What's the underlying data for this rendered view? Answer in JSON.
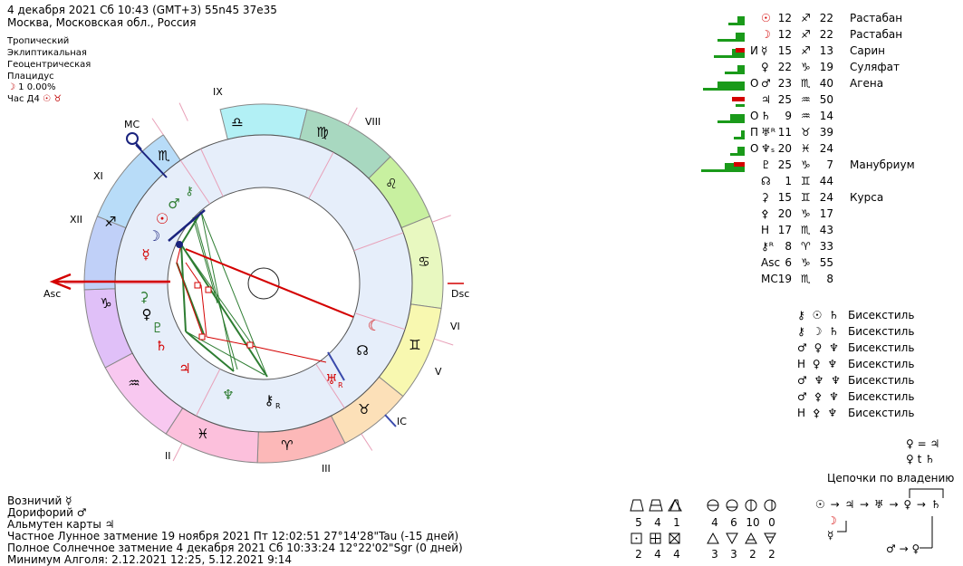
{
  "header": {
    "datetime": "4 декабря 2021  Сб  10:43 (GMT+3) 55n45  37e35",
    "place": "Москва, Московская обл., Россия",
    "settings": [
      "Тропический",
      "Эклиптикальная",
      "Геоцентрическая",
      "Плацидус"
    ],
    "moon_line_glyph": "☽",
    "moon_line_value": "1  0.00%",
    "hour_label": "Час Д4",
    "hour_glyphs": "☉ ♉"
  },
  "chart": {
    "house_labels": [
      "IX",
      "VIII",
      "VI",
      "V",
      "III",
      "II",
      "XI",
      "XII"
    ],
    "axis_labels": {
      "asc": "Asc",
      "dsc": "Dsc",
      "mc": "MC",
      "ic": "IC"
    },
    "signs": [
      "♎",
      "♍",
      "♌",
      "♋",
      "♊",
      "♉",
      "♈",
      "♓",
      "♒",
      "♑",
      "♐",
      "♏"
    ],
    "planet_glyphs": [
      "♂",
      "⚷",
      "☉",
      "☽",
      "☿",
      "♀",
      "♆",
      "⚷",
      "♅",
      "☊",
      "☾",
      "♄",
      "♃",
      "⚳",
      "♇"
    ],
    "retro_mark": "R"
  },
  "planets": [
    {
      "prefix": "",
      "glyph": "☉",
      "deg": "12",
      "sign": "♐",
      "min": "22",
      "star": "Растабан"
    },
    {
      "prefix": "",
      "glyph": "☽",
      "deg": "12",
      "sign": "♐",
      "min": "22",
      "star": "Растабан"
    },
    {
      "prefix": "И",
      "glyph": "☿",
      "deg": "15",
      "sign": "♐",
      "min": "13",
      "star": "Сарин"
    },
    {
      "prefix": "",
      "glyph": "♀",
      "deg": "22",
      "sign": "♑",
      "min": "19",
      "star": "Суляфат"
    },
    {
      "prefix": "О",
      "glyph": "♂",
      "deg": "23",
      "sign": "♏",
      "min": "40",
      "star": "Агена"
    },
    {
      "prefix": "",
      "glyph": "♃",
      "deg": "25",
      "sign": "♒",
      "min": "50",
      "star": ""
    },
    {
      "prefix": "О",
      "glyph": "♄",
      "deg": "9",
      "sign": "♒",
      "min": "14",
      "star": ""
    },
    {
      "prefix": "П",
      "glyph": "♅ᴿ",
      "deg": "11",
      "sign": "♉",
      "min": "39",
      "star": ""
    },
    {
      "prefix": "О",
      "glyph": "♆ₛ",
      "deg": "20",
      "sign": "♓",
      "min": "24",
      "star": ""
    },
    {
      "prefix": "",
      "glyph": "♇",
      "deg": "25",
      "sign": "♑",
      "min": "7",
      "star": "Манубриум"
    },
    {
      "prefix": "",
      "glyph": "☊",
      "deg": "1",
      "sign": "♊",
      "min": "44",
      "star": ""
    },
    {
      "prefix": "",
      "glyph": "⚳",
      "deg": "15",
      "sign": "♊",
      "min": "24",
      "star": "Курса"
    },
    {
      "prefix": "",
      "glyph": "⚴",
      "deg": "20",
      "sign": "♑",
      "min": "17",
      "star": ""
    },
    {
      "prefix": "",
      "glyph": "H",
      "deg": "17",
      "sign": "♏",
      "min": "43",
      "star": ""
    },
    {
      "prefix": "",
      "glyph": "⚷ᴿ",
      "deg": "8",
      "sign": "♈",
      "min": "33",
      "star": ""
    },
    {
      "prefix": "",
      "glyph": "Asc",
      "deg": "6",
      "sign": "♑",
      "min": "55",
      "star": ""
    },
    {
      "prefix": "",
      "glyph": "MC",
      "deg": "19",
      "sign": "♏",
      "min": "8",
      "star": ""
    }
  ],
  "aspects": [
    {
      "g": "⚷ ☉ ♄",
      "name": "Бисекстиль"
    },
    {
      "g": "⚷ ☽ ♄",
      "name": "Бисекстиль"
    },
    {
      "g": "♂ ♀ ♆",
      "name": "Бисекстиль"
    },
    {
      "g": "H ♀ ♆",
      "name": "Бисекстиль"
    },
    {
      "g": "♂ ♆ ♆",
      "name": "Бисекстиль"
    },
    {
      "g": "♂ ⚴ ♆",
      "name": "Бисекстиль"
    },
    {
      "g": "H ⚴ ♆",
      "name": "Бисекстиль"
    }
  ],
  "chains": {
    "eq1": "♀ = ♃",
    "eq2": "♀ t ♄",
    "title": "Цепочки по владению",
    "chain1": "☉ → ♃ → ♅ → ♀ → ♄",
    "moon": "☽",
    "mercury": "☿",
    "chain2": "♂ → ♀"
  },
  "footer": {
    "lines": [
      "Возничий  ☿",
      "Дорифорий  ♂",
      "Альмутен карты  ♃",
      "Частное Лунное затмение 19 ноября 2021 Пт 12:02:51 27°14'28\"Tau (-15 дней)",
      "Полное Солнечное затмение 4 декабря 2021 Сб 10:33:24 12°22'02\"Sgr (0 дней)",
      "Минимум Алголя: 2.12.2021 12:25,  5.12.2021  9:14"
    ]
  },
  "stats": {
    "top": [
      "5",
      "4",
      "1",
      "4",
      "6",
      "10",
      "0"
    ],
    "bottom": [
      "2",
      "4",
      "4",
      "3",
      "3",
      "2",
      "2"
    ]
  }
}
